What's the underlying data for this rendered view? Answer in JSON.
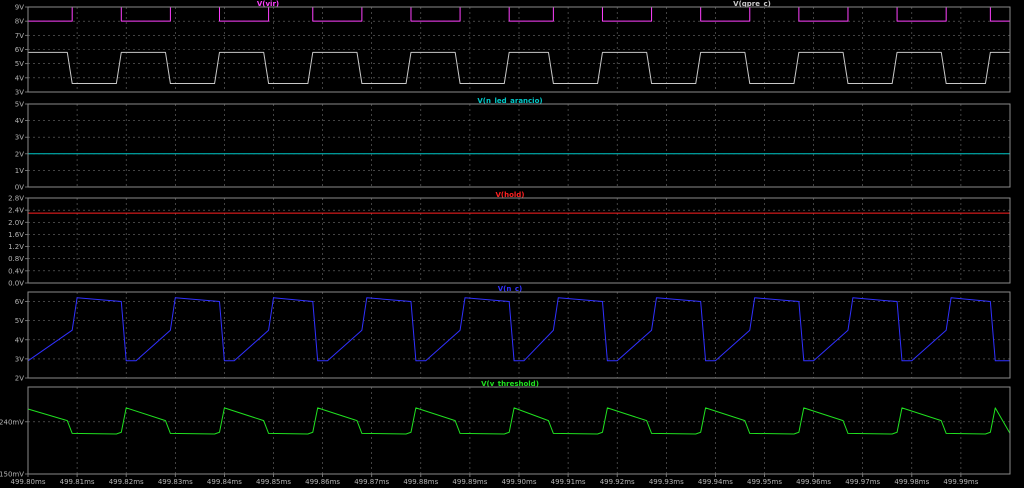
{
  "chart_data": [
    {
      "type": "line",
      "panel": 1,
      "series": [
        {
          "name": "V(vir)",
          "color": "#ff40ff",
          "x": [
            499.8,
            499.809,
            499.809,
            499.819,
            499.819,
            499.829,
            499.829,
            499.839,
            499.839,
            499.849,
            499.849,
            499.858,
            499.858,
            499.868,
            499.868,
            499.878,
            499.878,
            499.888,
            499.888,
            499.898,
            499.898,
            499.907,
            499.907,
            499.917,
            499.917,
            499.927,
            499.927,
            499.937,
            499.937,
            499.947,
            499.947,
            499.957,
            499.957,
            499.967,
            499.967,
            499.977,
            499.977,
            499.987,
            499.987,
            499.996,
            499.996,
            500.0
          ],
          "y": [
            8.0,
            8.0,
            9.0,
            9.0,
            8.0,
            8.0,
            9.0,
            9.0,
            8.0,
            8.0,
            9.0,
            9.0,
            8.0,
            8.0,
            9.0,
            9.0,
            8.0,
            8.0,
            9.0,
            9.0,
            8.0,
            8.0,
            9.0,
            9.0,
            8.0,
            8.0,
            9.0,
            9.0,
            8.0,
            8.0,
            9.0,
            9.0,
            8.0,
            8.0,
            9.0,
            9.0,
            8.0,
            8.0,
            9.0,
            9.0,
            8.0,
            8.0
          ]
        },
        {
          "name": "V(qpre_c)",
          "color": "#c8c8c8",
          "x": [
            499.8,
            499.808,
            499.809,
            499.818,
            499.819,
            499.828,
            499.829,
            499.838,
            499.839,
            499.848,
            499.849,
            499.857,
            499.858,
            499.867,
            499.868,
            499.877,
            499.878,
            499.887,
            499.888,
            499.897,
            499.898,
            499.906,
            499.907,
            499.916,
            499.917,
            499.926,
            499.927,
            499.936,
            499.937,
            499.946,
            499.947,
            499.956,
            499.957,
            499.966,
            499.967,
            499.976,
            499.977,
            499.986,
            499.987,
            499.995,
            499.996,
            500.0
          ],
          "y": [
            5.8,
            5.8,
            3.6,
            3.6,
            5.8,
            5.8,
            3.6,
            3.6,
            5.8,
            5.8,
            3.6,
            3.6,
            5.8,
            5.8,
            3.6,
            3.6,
            5.8,
            5.8,
            3.6,
            3.6,
            5.8,
            5.8,
            3.6,
            3.6,
            5.8,
            5.8,
            3.6,
            3.6,
            5.8,
            5.8,
            3.6,
            3.6,
            5.8,
            5.8,
            3.6,
            3.6,
            5.8,
            5.8,
            3.6,
            3.6,
            5.8,
            5.8
          ]
        }
      ],
      "ylim": [
        3,
        9
      ],
      "yticks": [
        "3V",
        "4V",
        "5V",
        "6V",
        "7V",
        "8V",
        "9V"
      ]
    },
    {
      "type": "line",
      "panel": 2,
      "series": [
        {
          "name": "V(n_led_arancio)",
          "color": "#00c8c8",
          "x": [
            499.8,
            500.0
          ],
          "y": [
            2.0,
            2.0
          ]
        }
      ],
      "ylim": [
        0,
        5
      ],
      "yticks": [
        "0V",
        "1V",
        "2V",
        "3V",
        "4V",
        "5V"
      ]
    },
    {
      "type": "line",
      "panel": 3,
      "series": [
        {
          "name": "V(hold)",
          "color": "#ff2020",
          "x": [
            499.8,
            500.0
          ],
          "y": [
            2.3,
            2.3
          ]
        }
      ],
      "ylim": [
        0,
        2.8
      ],
      "yticks": [
        "0.0V",
        "0.4V",
        "0.8V",
        "1.2V",
        "1.6V",
        "2.0V",
        "2.4V",
        "2.8V"
      ]
    },
    {
      "type": "line",
      "panel": 4,
      "series": [
        {
          "name": "V(n_c)",
          "color": "#3030ff",
          "x": [
            499.8,
            499.809,
            499.81,
            499.819,
            499.82,
            499.822,
            499.829,
            499.83,
            499.839,
            499.84,
            499.842,
            499.849,
            499.85,
            499.858,
            499.859,
            499.861,
            499.868,
            499.869,
            499.878,
            499.879,
            499.881,
            499.888,
            499.889,
            499.898,
            499.899,
            499.901,
            499.907,
            499.908,
            499.917,
            499.918,
            499.92,
            499.927,
            499.928,
            499.937,
            499.938,
            499.94,
            499.947,
            499.948,
            499.957,
            499.958,
            499.96,
            499.967,
            499.968,
            499.977,
            499.978,
            499.98,
            499.987,
            499.988,
            499.996,
            499.997,
            500.0
          ],
          "y": [
            2.9,
            4.5,
            6.2,
            6.0,
            2.9,
            2.9,
            4.5,
            6.2,
            6.0,
            2.9,
            2.9,
            4.5,
            6.2,
            6.0,
            2.9,
            2.9,
            4.5,
            6.2,
            6.0,
            2.9,
            2.9,
            4.5,
            6.2,
            6.0,
            2.9,
            2.9,
            4.5,
            6.2,
            6.0,
            2.9,
            2.9,
            4.5,
            6.2,
            6.0,
            2.9,
            2.9,
            4.5,
            6.2,
            6.0,
            2.9,
            2.9,
            4.5,
            6.2,
            6.0,
            2.9,
            2.9,
            4.5,
            6.2,
            6.0,
            2.9,
            2.9
          ]
        }
      ],
      "ylim": [
        2,
        6.5
      ],
      "yticks": [
        "2V",
        "3V",
        "4V",
        "5V",
        "6V"
      ]
    },
    {
      "type": "line",
      "panel": 5,
      "series": [
        {
          "name": "V(v_threshold)",
          "color": "#20e020",
          "x": [
            499.8,
            499.808,
            499.809,
            499.818,
            499.819,
            499.82,
            499.828,
            499.829,
            499.838,
            499.839,
            499.84,
            499.848,
            499.849,
            499.857,
            499.858,
            499.859,
            499.867,
            499.868,
            499.877,
            499.878,
            499.879,
            499.887,
            499.888,
            499.897,
            499.898,
            499.899,
            499.906,
            499.907,
            499.916,
            499.917,
            499.918,
            499.926,
            499.927,
            499.936,
            499.937,
            499.938,
            499.946,
            499.947,
            499.956,
            499.957,
            499.958,
            499.966,
            499.967,
            499.976,
            499.977,
            499.978,
            499.986,
            499.987,
            499.995,
            499.996,
            499.997,
            500.0
          ],
          "y": [
            0.262,
            0.242,
            0.22,
            0.219,
            0.222,
            0.264,
            0.242,
            0.22,
            0.219,
            0.222,
            0.264,
            0.242,
            0.22,
            0.219,
            0.222,
            0.264,
            0.242,
            0.22,
            0.219,
            0.222,
            0.264,
            0.242,
            0.22,
            0.219,
            0.222,
            0.264,
            0.242,
            0.22,
            0.219,
            0.222,
            0.264,
            0.242,
            0.22,
            0.219,
            0.222,
            0.264,
            0.242,
            0.22,
            0.219,
            0.222,
            0.264,
            0.242,
            0.22,
            0.219,
            0.222,
            0.264,
            0.242,
            0.22,
            0.219,
            0.222,
            0.264,
            0.22
          ]
        }
      ],
      "ylim": [
        0.15,
        0.3
      ],
      "yticks": [
        "150mV",
        "240mV"
      ],
      "ytick_values": [
        0.15,
        0.24
      ]
    }
  ],
  "xaxis": {
    "xlim": [
      499.8,
      500.0
    ],
    "ticks": [
      "499.80ms",
      "499.81ms",
      "499.82ms",
      "499.83ms",
      "499.84ms",
      "499.85ms",
      "499.86ms",
      "499.87ms",
      "499.88ms",
      "499.89ms",
      "499.90ms",
      "499.91ms",
      "499.92ms",
      "499.93ms",
      "499.94ms",
      "499.95ms",
      "499.96ms",
      "499.97ms",
      "499.98ms",
      "499.99ms"
    ],
    "tick_values": [
      499.8,
      499.81,
      499.82,
      499.83,
      499.84,
      499.85,
      499.86,
      499.87,
      499.88,
      499.89,
      499.9,
      499.91,
      499.92,
      499.93,
      499.94,
      499.95,
      499.96,
      499.97,
      499.98,
      499.99
    ]
  },
  "grid": true,
  "background": "#000000"
}
